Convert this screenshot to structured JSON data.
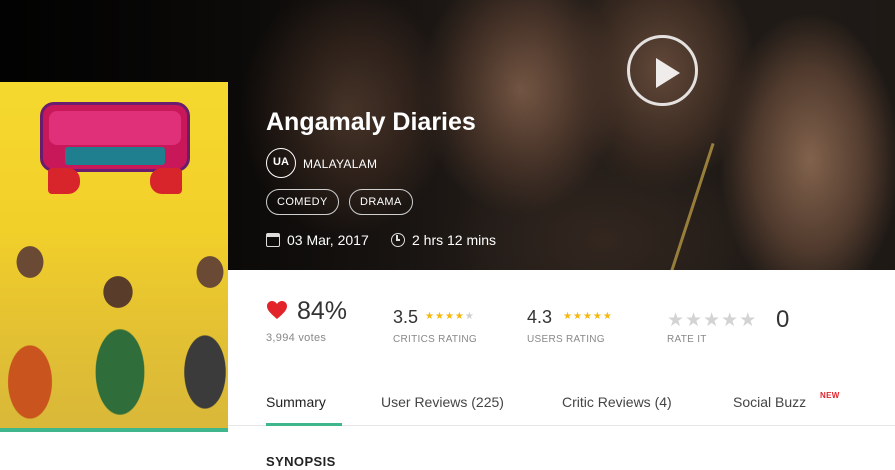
{
  "movie": {
    "title": "Angamaly Diaries",
    "certificate": "UA",
    "language": "MALAYALAM",
    "genres": [
      "COMEDY",
      "DRAMA"
    ],
    "release_date": "03 Mar, 2017",
    "duration": "2 hrs 12 mins"
  },
  "ratings": {
    "like_percent": "84%",
    "votes": "3,994 votes",
    "critics": {
      "score": "3.5",
      "label": "CRITICS RATING",
      "stars": 3.5
    },
    "users": {
      "score": "4.3",
      "label": "USERS RATING",
      "stars": 4.3
    },
    "rate_it": {
      "label": "RATE IT",
      "count": "0",
      "stars": 0
    }
  },
  "tabs": [
    {
      "label": "Summary",
      "active": true
    },
    {
      "label": "User Reviews (225)"
    },
    {
      "label": "Critic Reviews (4)"
    },
    {
      "label": "Social Buzz",
      "badge": "NEW"
    }
  ],
  "section_heading": "SYNOPSIS",
  "icons": {
    "play": "play-icon",
    "calendar": "calendar-icon",
    "clock": "clock-icon",
    "heart": "heart-icon",
    "star": "star-icon"
  },
  "colors": {
    "accent": "#3fb68b",
    "heart": "#e2232a",
    "star_on": "#f5b80f",
    "star_off": "#cfcfcf",
    "new_badge": "#e2232a"
  }
}
